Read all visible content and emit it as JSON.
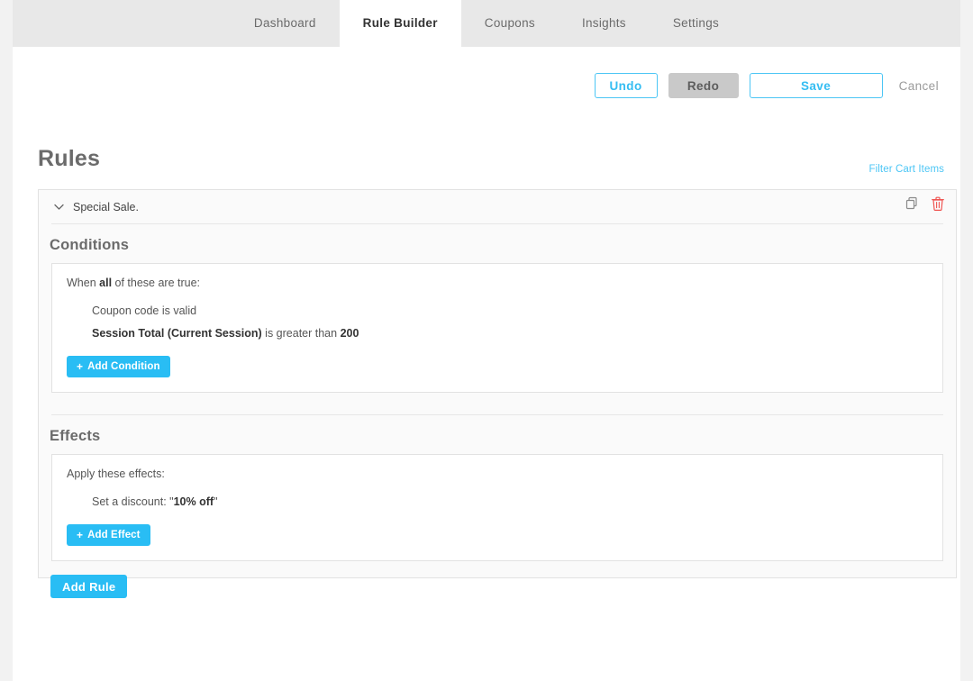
{
  "tabs": [
    {
      "label": "Dashboard",
      "active": false
    },
    {
      "label": "Rule Builder",
      "active": true
    },
    {
      "label": "Coupons",
      "active": false
    },
    {
      "label": "Insights",
      "active": false
    },
    {
      "label": "Settings",
      "active": false
    }
  ],
  "toolbar": {
    "undo_label": "Undo",
    "redo_label": "Redo",
    "save_label": "Save",
    "cancel_label": "Cancel"
  },
  "page": {
    "title": "Rules",
    "filter_link": "Filter Cart Items",
    "add_rule_label": "Add Rule"
  },
  "rule": {
    "name": "Special Sale.",
    "duplicate_icon": "copy-icon",
    "delete_icon": "trash-icon",
    "toggle_icon": "chevron-down-icon",
    "conditions": {
      "title": "Conditions",
      "lead_prefix": "When ",
      "lead_bold": "all",
      "lead_suffix": " of these are true:",
      "items": [
        {
          "prefix": "Coupon code is valid",
          "bold": "",
          "suffix": "",
          "bold2": ""
        },
        {
          "prefix": "",
          "bold": "Session Total (Current Session)",
          "suffix": " is greater than ",
          "bold2": "200"
        }
      ],
      "add_label": "Add Condition",
      "add_plus": "+"
    },
    "effects": {
      "title": "Effects",
      "lead": "Apply these effects:",
      "items": [
        {
          "prefix": "Set a discount: \"",
          "bold": "10% off",
          "suffix": "\""
        }
      ],
      "add_label": "Add Effect",
      "add_plus": "+"
    }
  },
  "colors": {
    "accent": "#29bdf4",
    "accent_outline": "#4cc6f5",
    "danger": "#ef5350",
    "muted": "#9a9a9a"
  }
}
